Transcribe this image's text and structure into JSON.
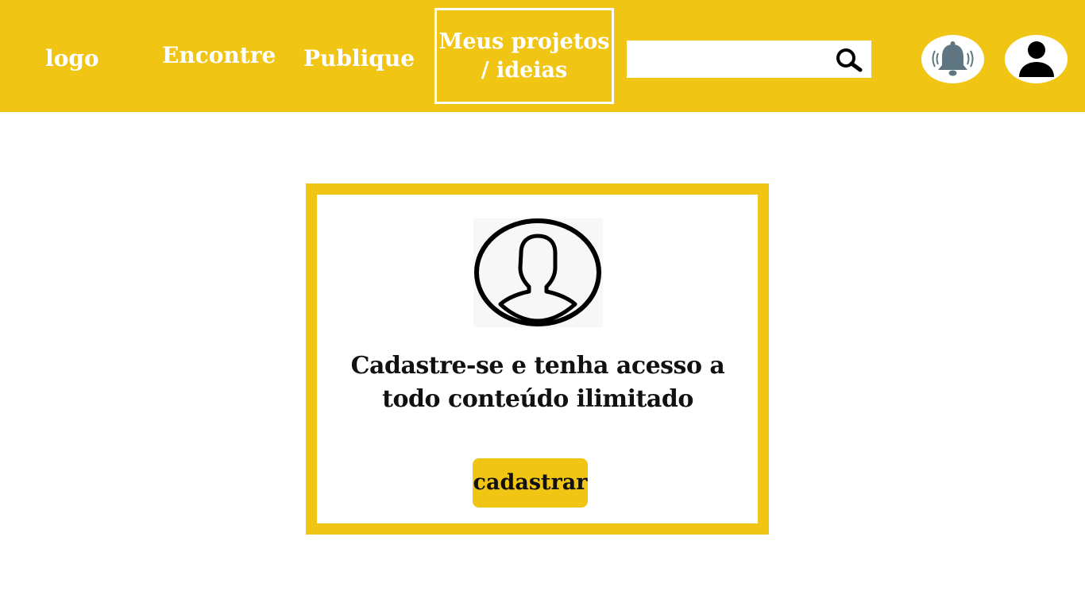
{
  "header": {
    "logo_text": "logo",
    "nav": {
      "encontre": "Encontre",
      "publique": "Publique",
      "meus_projetos_line1": "Meus projetos",
      "meus_projetos_line2": "/ ideias"
    },
    "search": {
      "value": "",
      "placeholder": "",
      "icon": "search-icon"
    },
    "notification_icon": "bell-icon",
    "profile_icon": "user-icon"
  },
  "card": {
    "avatar_icon": "user-profile-icon",
    "headline_line1": "Cadastre-se e tenha acesso a",
    "headline_line2": "todo conteúdo ilimitado",
    "button_label": "cadastrar"
  },
  "colors": {
    "accent": "#f0c514",
    "nav_text": "#ffffff",
    "bell": "#5f7582",
    "text": "#111111"
  }
}
